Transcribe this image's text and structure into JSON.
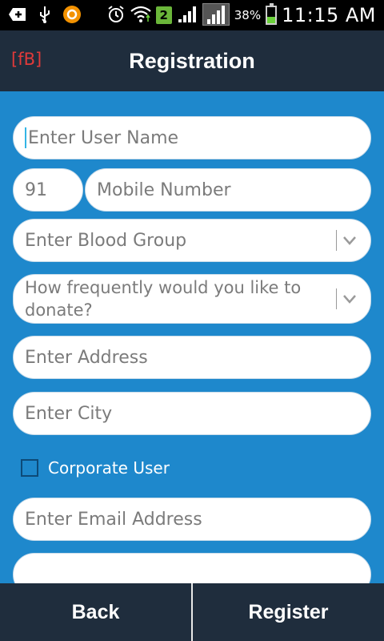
{
  "status_bar": {
    "battery_percent": "38%",
    "time": "11:15 AM",
    "notification_count": "2",
    "icons": [
      "image-add-icon",
      "usb-icon",
      "orange-app-icon",
      "alarm-icon",
      "wifi-icon",
      "signal-icon",
      "battery-charging-icon"
    ]
  },
  "header": {
    "logo": "[fB]",
    "title": "Registration"
  },
  "form": {
    "username_placeholder": "Enter User Name",
    "country_code": "91",
    "mobile_placeholder": "Mobile Number",
    "blood_group_placeholder": "Enter Blood Group",
    "frequency_placeholder": "How frequently would you like to donate?",
    "address_placeholder": "Enter Address",
    "city_placeholder": "Enter City",
    "corporate_user_label": "Corporate User",
    "corporate_user_checked": false,
    "email_placeholder": "Enter Email Address"
  },
  "bottom_bar": {
    "back_label": "Back",
    "register_label": "Register"
  },
  "colors": {
    "background": "#1e88cc",
    "header": "#1f2d3d",
    "logo": "#e03a3a"
  }
}
